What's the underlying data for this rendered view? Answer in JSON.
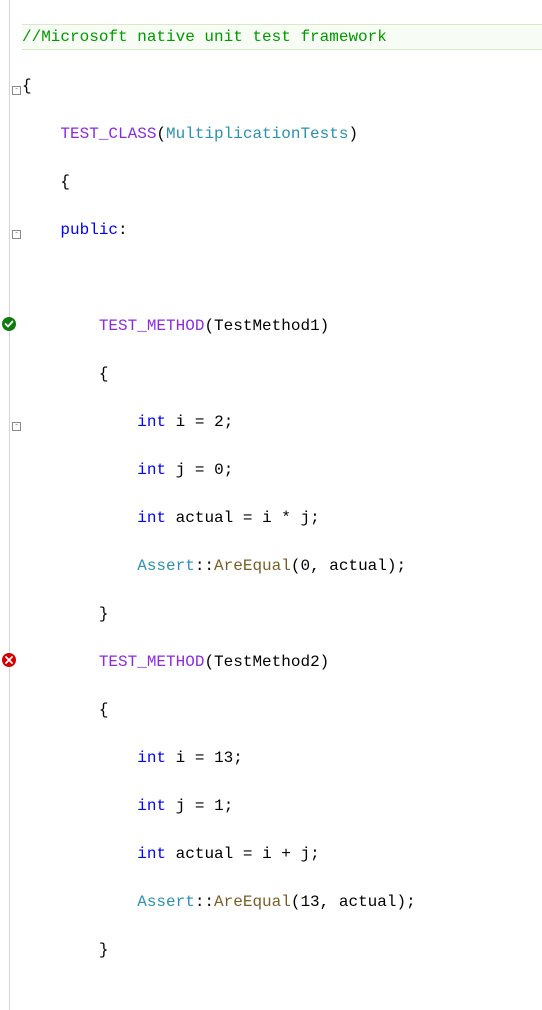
{
  "line1_comment": "//Microsoft native unit test framework",
  "line2": "{",
  "line3_macro": "TEST_CLASS",
  "line3_id": "MultiplicationTests",
  "line4": "{",
  "line5_kw": "public",
  "line5_colon": ":",
  "methods": [
    {
      "status": "pass",
      "macro": "TEST_METHOD",
      "name": "TestMethod1",
      "body": {
        "decl_i": {
          "kw": "int",
          "var": "i",
          "eq": "=",
          "val": "2"
        },
        "decl_j": {
          "kw": "int",
          "var": "j",
          "eq": "=",
          "val": "0"
        },
        "decl_actual": {
          "kw": "int",
          "var": "actual",
          "eq": "=",
          "expr": "i * j"
        },
        "assert": {
          "cls": "Assert",
          "sep": "::",
          "fn": "AreEqual",
          "arg0": "0",
          "arg1": "actual"
        }
      }
    },
    {
      "status": "fail",
      "macro": "TEST_METHOD",
      "name": "TestMethod2",
      "body": {
        "decl_i": {
          "kw": "int",
          "var": "i",
          "eq": "=",
          "val": "13"
        },
        "decl_j": {
          "kw": "int",
          "var": "j",
          "eq": "=",
          "val": "1"
        },
        "decl_actual": {
          "kw": "int",
          "var": "actual",
          "eq": "=",
          "expr": "i + j"
        },
        "assert": {
          "cls": "Assert",
          "sep": "::",
          "fn": "AreEqual",
          "arg0": "13",
          "arg1": "actual"
        }
      }
    }
  ]
}
